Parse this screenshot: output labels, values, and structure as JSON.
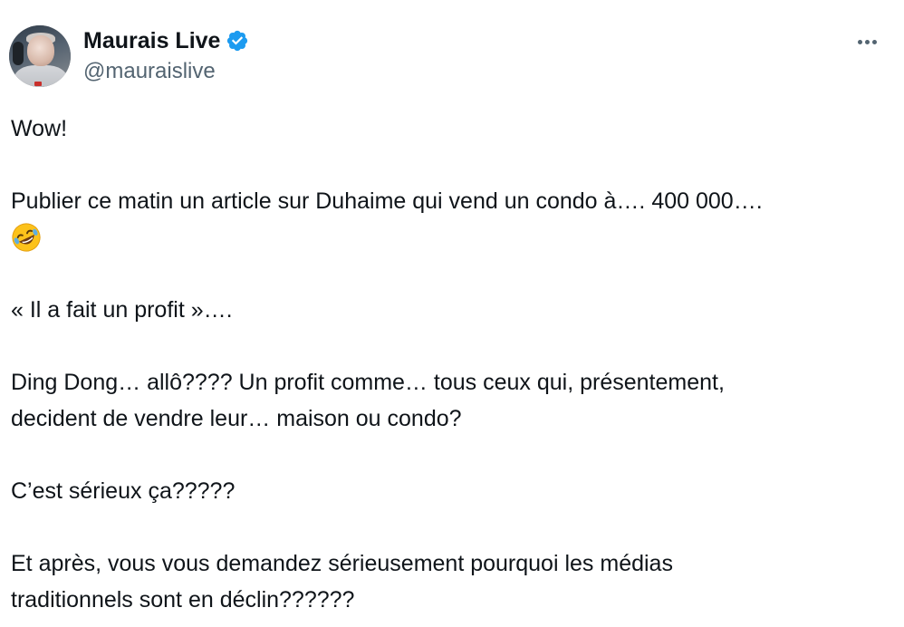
{
  "author": {
    "display_name": "Maurais Live",
    "handle": "@mauraislive",
    "verified_icon": "verified-badge-icon",
    "verified_color": "#1d9bf0"
  },
  "menu": {
    "more_icon": "more-options-icon"
  },
  "tweet": {
    "line1": "Wow!",
    "line2": "Publier ce matin un article sur Duhaime qui vend un condo à…. 400 000….",
    "emoji": "rolling-on-floor-laughing-emoji",
    "line3": "« Il a fait un profit »….",
    "line4a": "Ding Dong… allô????  Un profit comme… tous ceux qui, présentement,",
    "line4b": "decident de vendre leur… maison ou condo?",
    "line5": "C’est sérieux ça?????",
    "line6a": "Et après, vous vous demandez sérieusement pourquoi les médias",
    "line6b": "traditionnels sont en déclin??????"
  },
  "colors": {
    "text_primary": "#0f1419",
    "text_secondary": "#536471",
    "background": "#ffffff"
  }
}
